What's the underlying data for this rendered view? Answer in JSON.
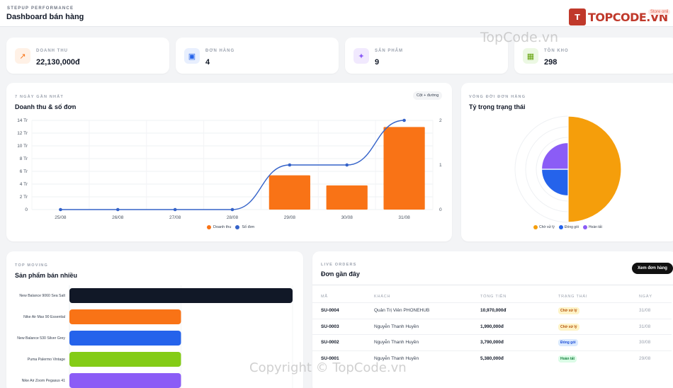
{
  "header": {
    "brand": "STEPUP PERFORMANCE",
    "title": "Dashboard bán hàng",
    "logo_mark": "T",
    "logo_text": "TOPCODE.VN",
    "store_badge": "Store onli"
  },
  "kpis": [
    {
      "label": "DOANH THU",
      "value": "22,130,000đ",
      "icon": "trend-up-icon",
      "icon_glyph": "↗",
      "bg": "#fff1e6",
      "fg": "#f97316"
    },
    {
      "label": "ĐƠN HÀNG",
      "value": "4",
      "icon": "shopping-bag-icon",
      "icon_glyph": "▣",
      "bg": "#e8effe",
      "fg": "#2563eb"
    },
    {
      "label": "SẢN PHẨM",
      "value": "9",
      "icon": "shoe-icon",
      "icon_glyph": "✦",
      "bg": "#f1e9fe",
      "fg": "#8b5cf6"
    },
    {
      "label": "TỒN KHO",
      "value": "298",
      "icon": "boxes-icon",
      "icon_glyph": "▦",
      "bg": "#ecf8e3",
      "fg": "#65a30d"
    }
  ],
  "revenue_panel": {
    "kicker": "7 NGÀY GẦN NHẤT",
    "title": "Doanh thu & số đơn",
    "mode_pill": "Cột + đường",
    "legend_revenue": "Doanh thu",
    "legend_orders": "Số đơn"
  },
  "status_panel": {
    "kicker": "VÒNG ĐỜI ĐƠN HÀNG",
    "title": "Tỷ trọng trạng thái"
  },
  "top_panel": {
    "kicker": "TOP MOVING",
    "title": "Sản phẩm bán nhiều"
  },
  "orders_panel": {
    "kicker": "LIVE ORDERS",
    "title": "Đơn gần đây",
    "button": "Xem đơn hàng",
    "columns": [
      "MÃ",
      "KHÁCH",
      "TỔNG TIỀN",
      "TRẠNG THÁI",
      "NGÀY"
    ],
    "rows": [
      {
        "code": "SU-0004",
        "customer": "Quản Trị Viên PHONEHUB",
        "total": "10,970,000đ",
        "status": "Chờ xử lý",
        "status_bg": "#fef3c7",
        "status_fg": "#b45309",
        "date": "31/08"
      },
      {
        "code": "SU-0003",
        "customer": "Nguyễn Thanh Huyền",
        "total": "1,990,000đ",
        "status": "Chờ xử lý",
        "status_bg": "#fef3c7",
        "status_fg": "#b45309",
        "date": "31/08"
      },
      {
        "code": "SU-0002",
        "customer": "Nguyễn Thanh Huyền",
        "total": "3,790,000đ",
        "status": "Đóng gói",
        "status_bg": "#dbeafe",
        "status_fg": "#1d4ed8",
        "date": "30/08"
      },
      {
        "code": "SU-0001",
        "customer": "Nguyễn Thanh Huyền",
        "total": "5,380,000đ",
        "status": "Hoàn tất",
        "status_bg": "#dcfce7",
        "status_fg": "#15803d",
        "date": "29/08"
      }
    ]
  },
  "watermarks": {
    "top": "TopCode.vn",
    "bottom": "Copyright © TopCode.vn"
  },
  "colors": {
    "bar": "#f97316",
    "line": "#3563c9",
    "pending": "#f59e0b",
    "packing": "#2563eb",
    "done": "#8b5cf6"
  },
  "chart_data": [
    {
      "type": "bar",
      "subtype": "bar+line",
      "categories": [
        "25/08",
        "26/08",
        "27/08",
        "28/08",
        "29/08",
        "30/08",
        "31/08"
      ],
      "series": [
        {
          "name": "Doanh thu",
          "type": "bar",
          "axis": "left",
          "values": [
            0,
            0,
            0,
            0,
            5.38,
            3.79,
            12.96
          ]
        },
        {
          "name": "Số đơn",
          "type": "line",
          "axis": "right",
          "values": [
            0,
            0,
            0,
            0,
            1,
            1,
            2
          ]
        }
      ],
      "y_left_ticks": [
        "0",
        "2 Tr",
        "4 Tr",
        "6 Tr",
        "8 Tr",
        "10 Tr",
        "12 Tr",
        "14 Tr"
      ],
      "y_left_range": [
        0,
        14
      ],
      "y_right_ticks": [
        "0",
        "1",
        "2"
      ],
      "y_right_range": [
        0,
        2
      ],
      "grid": true,
      "legend_position": "bottom-center"
    },
    {
      "type": "pie",
      "subtype": "polar-area",
      "labels": [
        "Chờ xử lý",
        "Đóng gói",
        "Hoàn tất"
      ],
      "values": [
        2,
        1,
        1
      ],
      "radius_levels": [
        2,
        1,
        1
      ],
      "radius_max": 2,
      "grid": true,
      "legend_position": "bottom-center"
    },
    {
      "type": "bar",
      "orientation": "horizontal",
      "categories": [
        "New Balance 9060 Sea Salt",
        "Nike Air Max 90 Essential",
        "New Balance 530 Silver Grey",
        "Puma Palermo Vintage",
        "Nike Air Zoom Pegasus 41"
      ],
      "values": [
        2,
        1,
        1,
        1,
        1
      ],
      "colors": [
        "#111827",
        "#f97316",
        "#2563eb",
        "#84cc16",
        "#8b5cf6"
      ],
      "xlim": [
        0,
        2
      ],
      "grid": true
    }
  ]
}
